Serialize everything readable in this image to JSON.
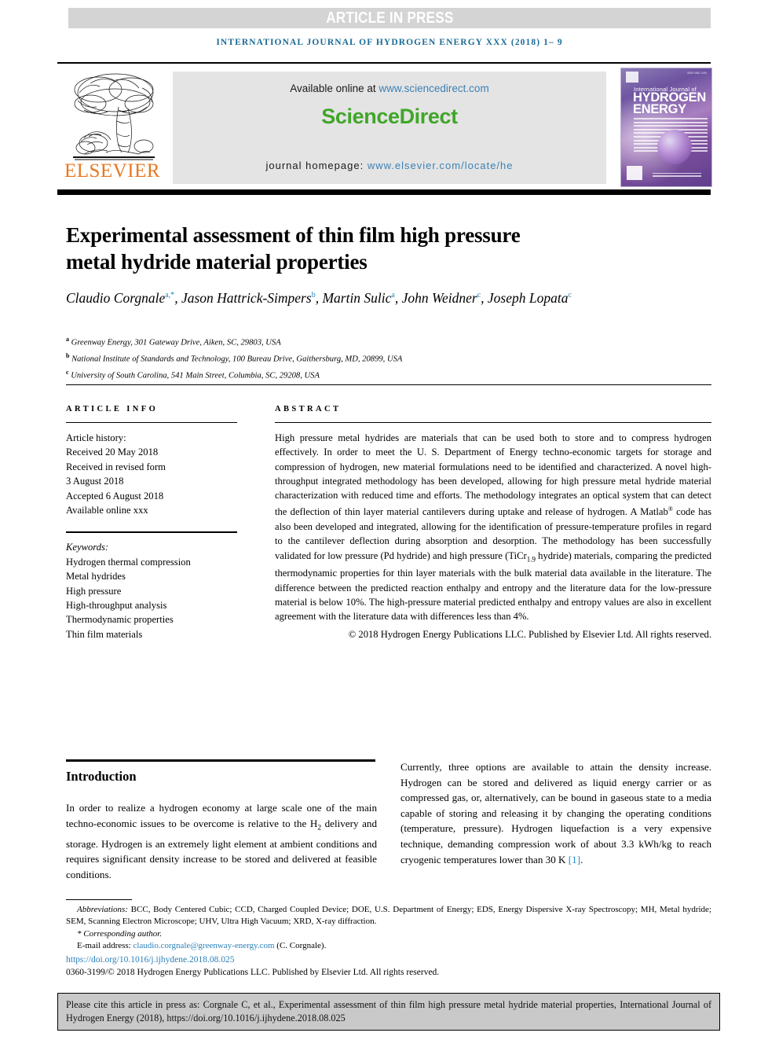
{
  "banner": {
    "article_in_press": "ARTICLE IN PRESS"
  },
  "running_head": "INTERNATIONAL JOURNAL OF HYDROGEN ENERGY XXX (2018) 1– 9",
  "masthead": {
    "publisher_name": "ELSEVIER",
    "available_prefix": "Available online at ",
    "sciencedirect_url": "www.sciencedirect.com",
    "sciencedirect_logo": "ScienceDirect",
    "homepage_prefix": "journal homepage: ",
    "homepage_url": "www.elsevier.com/locate/he",
    "cover": {
      "line1": "International Journal of",
      "line2": "HYDROGEN",
      "line3": "ENERGY",
      "issn": "ISSN 0360-3199",
      "footer": "ScienceDirect"
    }
  },
  "article": {
    "title": "Experimental assessment of thin film high pressure metal hydride material properties",
    "authors": [
      {
        "name": "Claudio Corgnale",
        "marks": "a,*"
      },
      {
        "name": "Jason Hattrick-Simpers",
        "marks": "b"
      },
      {
        "name": "Martin Sulic",
        "marks": "a"
      },
      {
        "name": "John Weidner",
        "marks": "c"
      },
      {
        "name": "Joseph Lopata",
        "marks": "c"
      }
    ],
    "affiliations": [
      {
        "mark": "a",
        "text": "Greenway Energy, 301 Gateway Drive, Aiken, SC, 29803, USA"
      },
      {
        "mark": "b",
        "text": "National Institute of Standards and Technology, 100 Bureau Drive, Gaithersburg, MD, 20899, USA"
      },
      {
        "mark": "c",
        "text": "University of South Carolina, 541 Main Street, Columbia, SC, 29208, USA"
      }
    ]
  },
  "article_info": {
    "heading": "ARTICLE INFO",
    "history_label": "Article history:",
    "history": [
      "Received 20 May 2018",
      "Received in revised form",
      "3 August 2018",
      "Accepted 6 August 2018",
      "Available online xxx"
    ],
    "keywords_label": "Keywords:",
    "keywords": [
      "Hydrogen thermal compression",
      "Metal hydrides",
      "High pressure",
      "High-throughput analysis",
      "Thermodynamic properties",
      "Thin film materials"
    ]
  },
  "abstract": {
    "heading": "ABSTRACT",
    "part1": "High pressure metal hydrides are materials that can be used both to store and to compress hydrogen effectively. In order to meet the U. S. Department of Energy techno-economic targets for storage and compression of hydrogen, new material formulations need to be identified and characterized. A novel high-throughput integrated methodology has been developed, allowing for high pressure metal hydride material characterization with reduced time and efforts. The methodology integrates an optical system that can detect the deflection of thin layer material cantilevers during uptake and release of hydrogen. A Matlab",
    "reg_mark": "®",
    "part2": " code has also been developed and integrated, allowing for the identification of pressure-temperature profiles in regard to the cantilever deflection during absorption and desorption. The methodology has been successfully validated for low pressure (Pd hydride) and high pressure (TiCr",
    "sub": "1.9",
    "part3": " hydride) materials, comparing the predicted thermodynamic properties for thin layer materials with the bulk material data available in the literature. The difference between the predicted reaction enthalpy and entropy and the literature data for the low-pressure material is below 10%. The high-pressure material predicted enthalpy and entropy values are also in excellent agreement with the literature data with differences less than 4%.",
    "copyright": "© 2018 Hydrogen Energy Publications LLC. Published by Elsevier Ltd. All rights reserved."
  },
  "body": {
    "intro_heading": "Introduction",
    "left_paragraph_pre": "In order to realize a hydrogen economy at large scale one of the main techno-economic issues to be overcome is relative to the H",
    "left_sub": "2",
    "left_paragraph_post": " delivery and storage. Hydrogen is an extremely light element at ambient conditions and requires significant density increase to be stored and delivered at feasible conditions.",
    "right_paragraph": "Currently, three options are available to attain the density increase. Hydrogen can be stored and delivered as liquid energy carrier or as compressed gas, or, alternatively, can be bound in gaseous state to a media capable of storing and releasing it by changing the operating conditions (temperature, pressure). Hydrogen liquefaction is a very expensive technique, demanding compression work of about 3.3 kWh/kg to reach cryogenic temperatures lower than 30 K ",
    "right_reference": "[1]",
    "right_paragraph_end": "."
  },
  "footnotes": {
    "abbreviations_label": "Abbreviations:",
    "abbreviations_text": " BCC, Body Centered Cubic; CCD, Charged Coupled Device; DOE, U.S. Department of Energy; EDS, Energy Dispersive X-ray Spectroscopy; MH, Metal hydride; SEM, Scanning Electron Microscope; UHV, Ultra High Vacuum; XRD, X-ray diffraction.",
    "corresponding_author": "* Corresponding author.",
    "email_label": "E-mail address: ",
    "email_address": "claudio.corgnale@greenway-energy.com",
    "email_suffix": " (C. Corgnale).",
    "doi": "https://doi.org/10.1016/j.ijhydene.2018.08.025",
    "issn_line": "0360-3199/© 2018 Hydrogen Energy Publications LLC. Published by Elsevier Ltd. All rights reserved."
  },
  "cite_box": {
    "text": "Please cite this article in press as: Corgnale C, et al., Experimental assessment of thin film high pressure metal hydride material properties, International Journal of Hydrogen Energy (2018), https://doi.org/10.1016/j.ijhydene.2018.08.025"
  },
  "colors": {
    "running_head": "#1a6b96",
    "elsevier_orange": "#e87722",
    "sciencedirect_green": "#40a629",
    "link_blue": "#3d81b5",
    "ref_blue": "#1a8ac4",
    "banner_gray": "#d4d4d4",
    "band_gray": "#e4e4e4",
    "cite_gray": "#c9c9c9"
  }
}
